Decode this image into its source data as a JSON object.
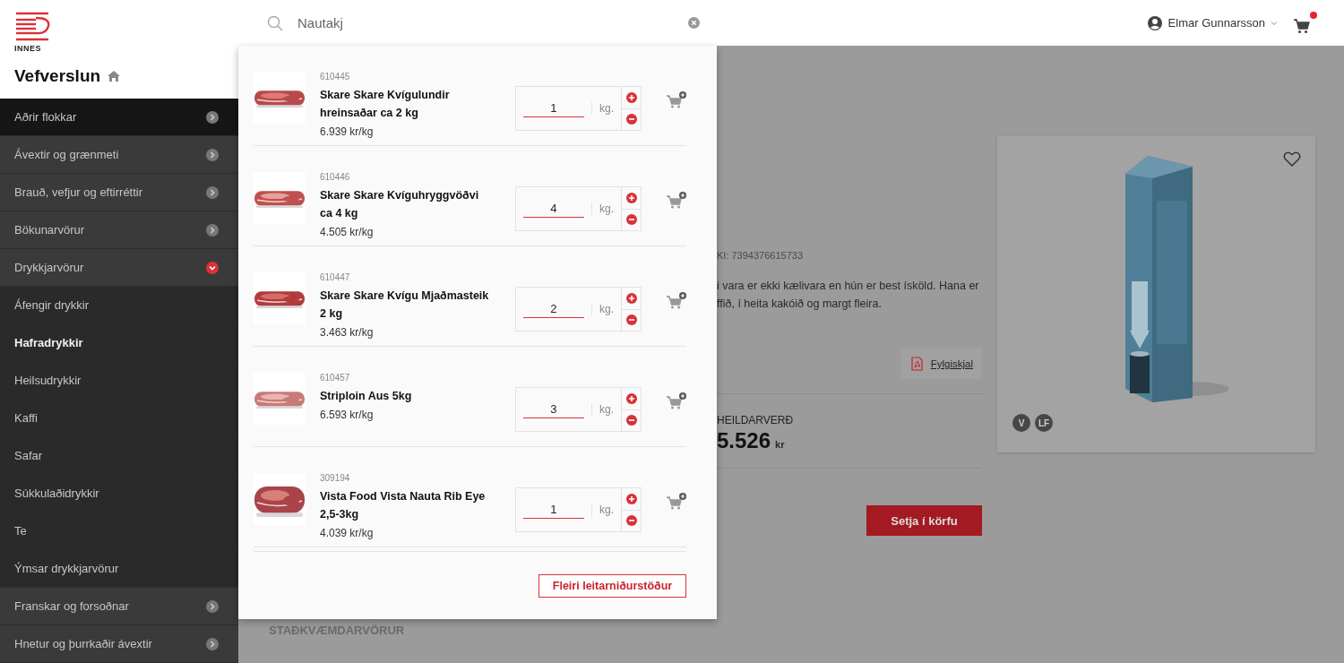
{
  "brand": {
    "logo_text": "INNES",
    "title": "Vefverslun"
  },
  "sidebar": {
    "items": [
      {
        "label": "Aðrir flokkar",
        "highlighted": true,
        "expanded": false
      },
      {
        "label": "Ávextir og grænmeti",
        "highlighted": false,
        "expanded": false
      },
      {
        "label": "Brauð, vefjur og eftirréttir",
        "highlighted": false,
        "expanded": false
      },
      {
        "label": "Bökunarvörur",
        "highlighted": false,
        "expanded": false
      },
      {
        "label": "Drykkjarvörur",
        "highlighted": false,
        "expanded": true,
        "children": [
          {
            "label": "Áfengir drykkir",
            "selected": false
          },
          {
            "label": "Hafradrykkir",
            "selected": true
          },
          {
            "label": "Heilsudrykkir",
            "selected": false
          },
          {
            "label": "Kaffi",
            "selected": false
          },
          {
            "label": "Safar",
            "selected": false
          },
          {
            "label": "Súkkulaðidrykkir",
            "selected": false
          },
          {
            "label": "Te",
            "selected": false
          },
          {
            "label": "Ýmsar drykkjarvörur",
            "selected": false
          }
        ]
      },
      {
        "label": "Franskar og forsoðnar",
        "highlighted": false,
        "expanded": false
      },
      {
        "label": "Hnetur og þurrkaðir ávextir",
        "highlighted": false,
        "expanded": false
      }
    ]
  },
  "header": {
    "search": {
      "value": "Nautakj"
    },
    "user": {
      "name": "Elmar Gunnarsson"
    },
    "cart": {
      "has_notification": true
    }
  },
  "search_results": {
    "products": [
      {
        "code": "610445",
        "name": "Skare Skare Kvígulundir hreinsaðar ca 2 kg",
        "price": "6.939 kr/kg",
        "quantity": "1",
        "unit": "kg."
      },
      {
        "code": "610446",
        "name": "Skare Skare Kvíguhryggvöðvi ca 4 kg",
        "price": "4.505 kr/kg",
        "quantity": "4",
        "unit": "kg."
      },
      {
        "code": "610447",
        "name": "Skare Skare Kvígu Mjaðmasteik 2 kg",
        "price": "3.463 kr/kg",
        "quantity": "2",
        "unit": "kg."
      },
      {
        "code": "610457",
        "name": "Striploin Aus 5kg",
        "price": "6.593 kr/kg",
        "quantity": "3",
        "unit": "kg."
      },
      {
        "code": "309194",
        "name": "Vista Food Vista Nauta Rib Eye 2,5-3kg",
        "price": "4.039 kr/kg",
        "quantity": "1",
        "unit": "kg."
      }
    ],
    "more_button": "Fleiri leitarniðurstöður"
  },
  "product": {
    "barcode": "KI: 7394376615733",
    "description": [
      "i vara er ekki kælivara en hún er best ísköld. Hana er",
      "ffið, í heita kakóið og margt fleira."
    ],
    "attachment": "Fylgiskjal",
    "total_label": "HEILDARVERÐ",
    "total": "5.526",
    "currency": "kr",
    "add_button": "Setja í körfu",
    "badges": [
      "V",
      "LF"
    ],
    "favorite": false
  },
  "related": {
    "title": "STAÐKVÆMDARVÖRUR"
  }
}
